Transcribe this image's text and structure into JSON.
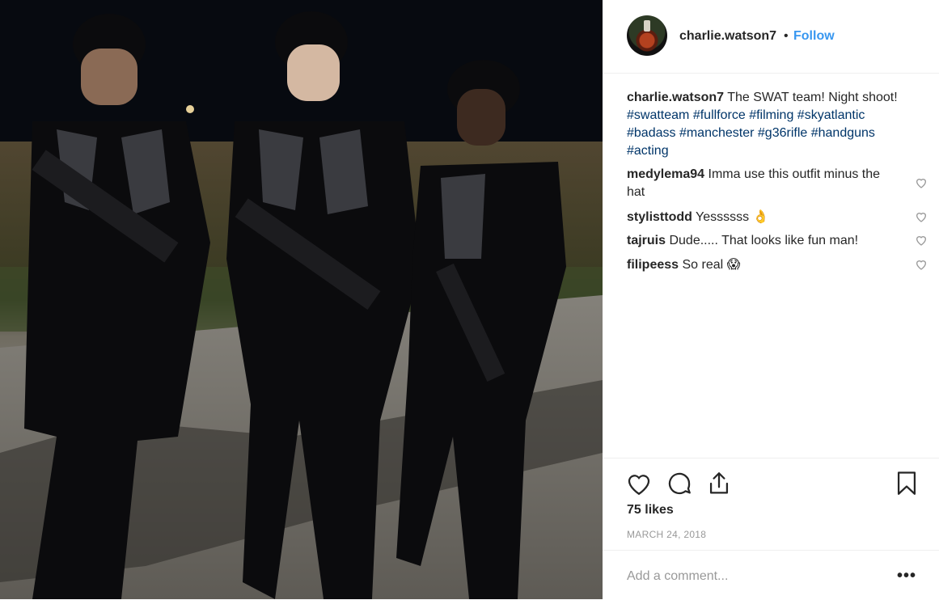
{
  "post": {
    "image_alt": "Three people in black SWAT tactical gear holding rifles at night",
    "header": {
      "username": "charlie.watson7",
      "separator": "•",
      "follow_label": "Follow"
    },
    "caption": {
      "username": "charlie.watson7",
      "text": "The SWAT team! Night shoot!",
      "hashtags": [
        "#swatteam",
        "#fullforce",
        "#filming",
        "#skyatlantic",
        "#badass",
        "#manchester",
        "#g36rifle",
        "#handguns",
        "#acting"
      ]
    },
    "comments": [
      {
        "username": "medylema94",
        "text": "Imma use this outfit minus the hat"
      },
      {
        "username": "stylisttodd",
        "text": "Yessssss 👌"
      },
      {
        "username": "tajruis",
        "text": "Dude..... That looks like fun man!"
      },
      {
        "username": "filipeess",
        "text": "So real 😱"
      }
    ],
    "likes": "75 likes",
    "date": "MARCH 24, 2018",
    "add_comment_placeholder": "Add a comment...",
    "more_label": "•••"
  },
  "icons": {
    "like": "heart-icon",
    "comment": "speech-bubble-icon",
    "share": "share-icon",
    "save": "bookmark-icon",
    "comment_like": "small-heart-icon"
  },
  "colors": {
    "link": "#3897f0",
    "hashtag": "#003569",
    "muted": "#999999",
    "text": "#262626"
  }
}
